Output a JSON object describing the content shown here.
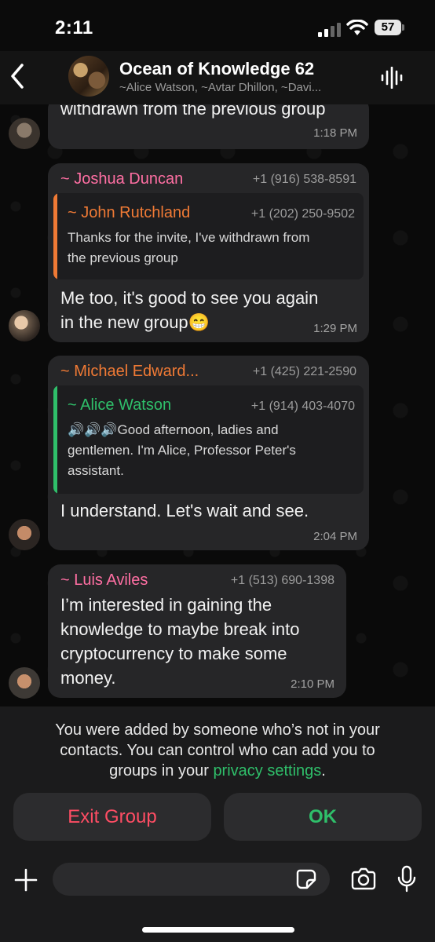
{
  "status_bar": {
    "time": "2:11",
    "battery": "57"
  },
  "header": {
    "group_name": "Ocean of Knowledge  62",
    "members": "~Alice Watson, ~Avtar Dhillon, ~Davi..."
  },
  "messages": [
    {
      "text": "withdrawn from the previous group",
      "time": "1:18 PM"
    },
    {
      "sender": "~ Joshua Duncan",
      "sender_color": "#ff6fa3",
      "phone": "+1 (916) 538-8591",
      "quote": {
        "name": "~ John Rutchland",
        "name_color": "#f07a35",
        "bar_color": "#f07a35",
        "phone": "+1 (202) 250-9502",
        "lines": [
          "Thanks for the invite, I've withdrawn from",
          "the previous group"
        ]
      },
      "lines": [
        "Me too, it's good to see you again",
        "in the new group😁"
      ],
      "time": "1:29 PM"
    },
    {
      "sender": "~ Michael Edward...",
      "sender_color": "#f07a35",
      "phone": "+1 (425) 221-2590",
      "quote": {
        "name": "~ Alice Watson",
        "name_color": "#2fbf6a",
        "bar_color": "#2fbf6a",
        "phone": "+1 (914) 403-4070",
        "lines": [
          "🔊🔊🔊Good afternoon, ladies and",
          "gentlemen. I'm Alice, Professor Peter's",
          "assistant."
        ]
      },
      "lines": [
        "I understand. Let's wait and see."
      ],
      "time": "2:04 PM"
    },
    {
      "sender": "~ Luis Aviles",
      "sender_color": "#ff6fa3",
      "phone": "+1 (513) 690-1398",
      "lines": [
        "I’m interested in gaining the",
        "knowledge to maybe break into",
        "cryptocurrency to make some",
        "money."
      ],
      "time": "2:10 PM"
    }
  ],
  "notice": {
    "line1": "You were added by someone who’s not in your",
    "line2": "contacts. You can control who can add you to",
    "line3_prefix": "groups in your ",
    "link": "privacy settings",
    "line3_suffix": "."
  },
  "buttons": {
    "exit": "Exit Group",
    "ok": "OK"
  },
  "composer": {
    "placeholder": ""
  }
}
